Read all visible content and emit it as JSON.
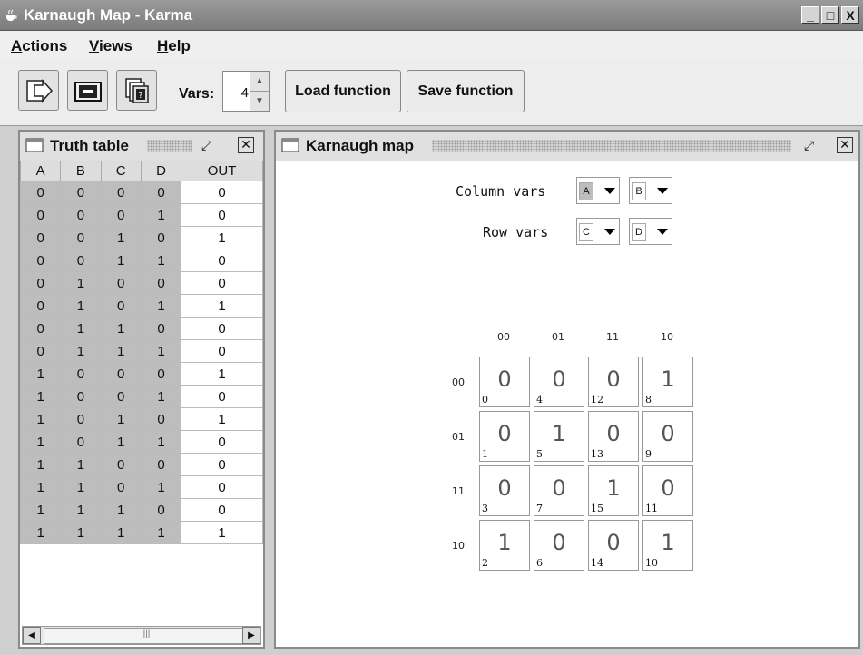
{
  "window": {
    "title": "Karnaugh Map - Karma",
    "buttons": [
      "_",
      "□",
      "X"
    ]
  },
  "menu": {
    "items": [
      {
        "first": "A",
        "rest": "ctions"
      },
      {
        "first": "V",
        "rest": "iews"
      },
      {
        "first": "H",
        "rest": "elp"
      }
    ]
  },
  "toolbar": {
    "tools": [
      "forward-arrow-icon",
      "monitor-icon",
      "help-pages-icon"
    ],
    "vars_label": "Vars:",
    "vars_value": "4",
    "load_label": "Load function",
    "save_label": "Save function"
  },
  "truth_table": {
    "title": "Truth table",
    "headers": [
      "A",
      "B",
      "C",
      "D",
      "OUT"
    ],
    "rows": [
      [
        "0",
        "0",
        "0",
        "0",
        "0"
      ],
      [
        "0",
        "0",
        "0",
        "1",
        "0"
      ],
      [
        "0",
        "0",
        "1",
        "0",
        "1"
      ],
      [
        "0",
        "0",
        "1",
        "1",
        "0"
      ],
      [
        "0",
        "1",
        "0",
        "0",
        "0"
      ],
      [
        "0",
        "1",
        "0",
        "1",
        "1"
      ],
      [
        "0",
        "1",
        "1",
        "0",
        "0"
      ],
      [
        "0",
        "1",
        "1",
        "1",
        "0"
      ],
      [
        "1",
        "0",
        "0",
        "0",
        "1"
      ],
      [
        "1",
        "0",
        "0",
        "1",
        "0"
      ],
      [
        "1",
        "0",
        "1",
        "0",
        "1"
      ],
      [
        "1",
        "0",
        "1",
        "1",
        "0"
      ],
      [
        "1",
        "1",
        "0",
        "0",
        "0"
      ],
      [
        "1",
        "1",
        "0",
        "1",
        "0"
      ],
      [
        "1",
        "1",
        "1",
        "0",
        "0"
      ],
      [
        "1",
        "1",
        "1",
        "1",
        "1"
      ]
    ]
  },
  "kmap": {
    "title": "Karnaugh map",
    "column_vars_label": "Column vars",
    "row_vars_label": "Row vars",
    "column_vars": [
      "A",
      "B"
    ],
    "row_vars": [
      "C",
      "D"
    ],
    "column_headers": [
      "00",
      "01",
      "11",
      "10"
    ],
    "row_headers": [
      "00",
      "01",
      "11",
      "10"
    ],
    "cells": [
      [
        {
          "v": "0",
          "m": "0"
        },
        {
          "v": "0",
          "m": "4"
        },
        {
          "v": "0",
          "m": "12"
        },
        {
          "v": "1",
          "m": "8"
        }
      ],
      [
        {
          "v": "0",
          "m": "1"
        },
        {
          "v": "1",
          "m": "5"
        },
        {
          "v": "0",
          "m": "13"
        },
        {
          "v": "0",
          "m": "9"
        }
      ],
      [
        {
          "v": "0",
          "m": "3"
        },
        {
          "v": "0",
          "m": "7"
        },
        {
          "v": "1",
          "m": "15"
        },
        {
          "v": "0",
          "m": "11"
        }
      ],
      [
        {
          "v": "1",
          "m": "2"
        },
        {
          "v": "0",
          "m": "6"
        },
        {
          "v": "0",
          "m": "14"
        },
        {
          "v": "1",
          "m": "10"
        }
      ]
    ]
  }
}
